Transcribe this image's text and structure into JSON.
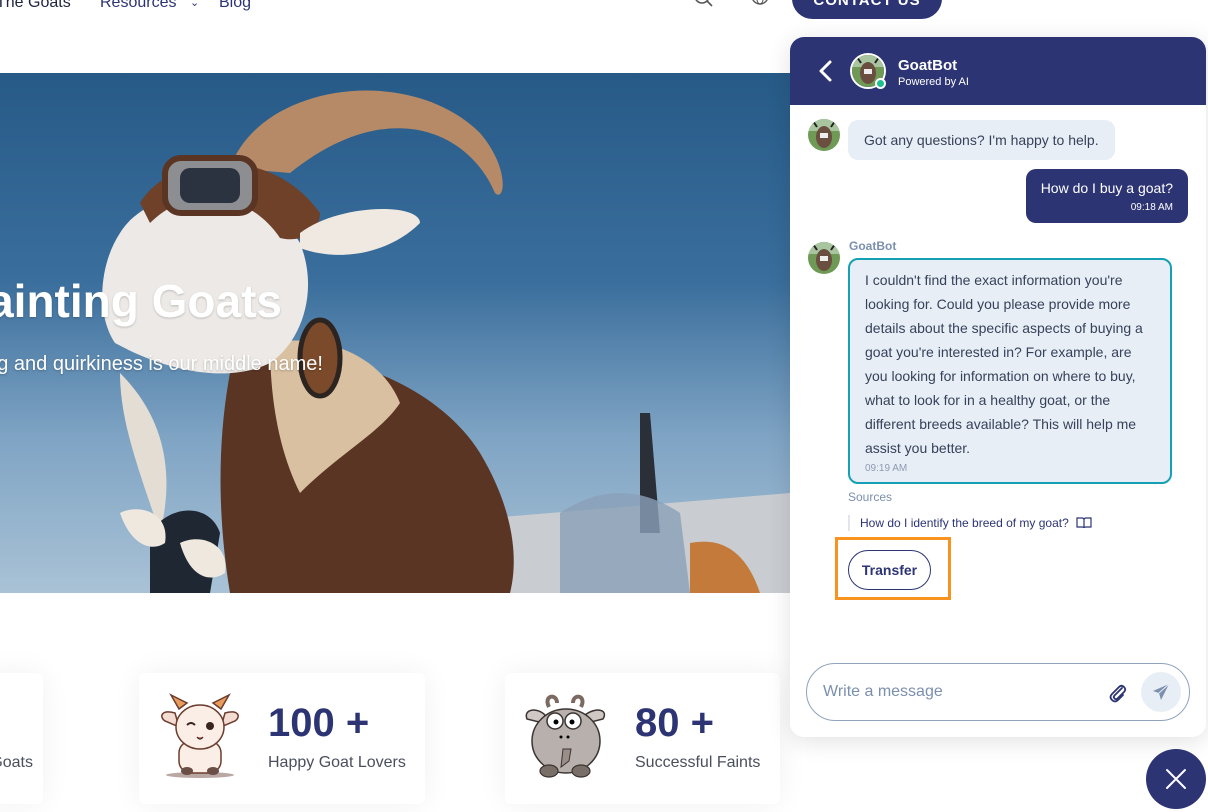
{
  "nav": {
    "links": [
      "The Goats",
      "Resources",
      "Blog"
    ],
    "resources_chevron": "chevron-down",
    "contact_label": "CONTACT US"
  },
  "hero": {
    "title": "Fainting Goats",
    "subtitle": "Where fun meets fainting and quirkiness is our middle name!"
  },
  "stats": [
    {
      "number": "",
      "label": "Goats"
    },
    {
      "number": "100 +",
      "label": "Happy Goat Lovers"
    },
    {
      "number": "80 +",
      "label": "Successful Faints"
    }
  ],
  "chat": {
    "bot_name": "GoatBot",
    "bot_subtitle": "Powered by AI",
    "status": "online",
    "messages": [
      {
        "from": "bot",
        "text": "Got any questions? I'm happy to help."
      },
      {
        "from": "user",
        "text": "How do I buy a goat?",
        "time": "09:18 AM"
      },
      {
        "from": "bot",
        "sender": "GoatBot",
        "text": "I couldn't find the exact information you're looking for. Could you please provide more details about the specific aspects of buying a goat you're interested in? For example, are you looking for information on where to buy, what to look for in a healthy goat, or the different breeds available? This will help me assist you better.",
        "time": "09:19 AM"
      }
    ],
    "sources_label": "Sources",
    "sources": [
      "How do I identify the breed of my goat?"
    ],
    "transfer_label": "Transfer",
    "input_placeholder": "Write a message",
    "input_value": ""
  },
  "colors": {
    "brand": "#2c3474",
    "bot_bubble": "#e8eef6",
    "highlight_border": "#15a0b4",
    "annotation": "#f7931e",
    "online": "#1fbf8f"
  }
}
